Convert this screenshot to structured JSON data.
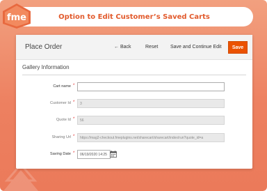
{
  "banner": {
    "title": "Option to Edit Customer’s Saved Carts",
    "logo_icon": "fme-logo-icon"
  },
  "colors": {
    "background": "#ed8060",
    "accent": "#eb5202",
    "title_text": "#e25a2c"
  },
  "toolbar": {
    "page_title": "Place Order",
    "back_label": "← Back",
    "reset_label": "Reset",
    "save_continue_label": "Save and Continue Edit",
    "save_label": "Save"
  },
  "form": {
    "section_title": "Gallery Information",
    "fields": [
      {
        "label": "Cart name",
        "value": "",
        "required": "*",
        "disabled": false
      },
      {
        "label": "Customer Id",
        "value": "3",
        "required": "*",
        "disabled": true
      },
      {
        "label": "Quote Id",
        "value": "56",
        "required": "*",
        "disabled": true
      },
      {
        "label": "Sharing Url",
        "value": "https://mag2-checkout.fmeplugins.net/sharecart/sharecart/index/run?quote_id=a",
        "required": "*",
        "disabled": true
      },
      {
        "label": "Saving Date",
        "value": "06/19/2020 14:25",
        "required": "*",
        "disabled": false,
        "icon": "calendar-icon"
      }
    ]
  }
}
